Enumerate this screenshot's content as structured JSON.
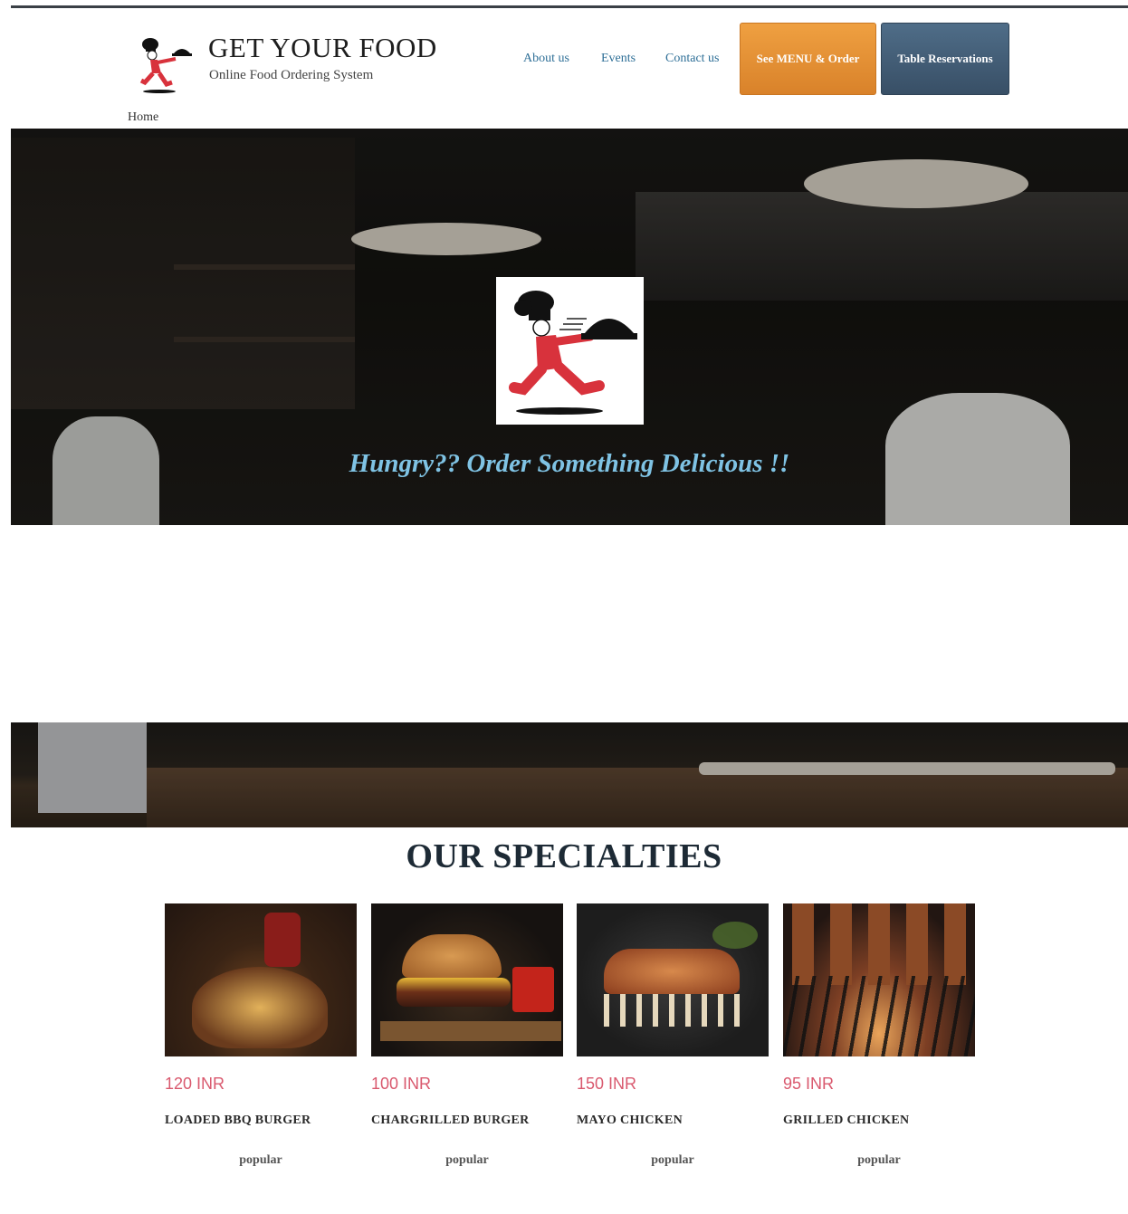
{
  "header": {
    "brand_title": "GET YOUR FOOD",
    "brand_subtitle": "Online Food Ordering System",
    "nav": [
      {
        "label": "About us"
      },
      {
        "label": "Events"
      },
      {
        "label": "Contact us"
      }
    ],
    "menu_button": "See MENU & Order",
    "table_button": "Table Reservations"
  },
  "breadcrumb": "Home",
  "hero": {
    "tagline": "Hungry?? Order Something Delicious !!"
  },
  "specialties": {
    "title": "OUR SPECIALTIES",
    "items": [
      {
        "price": "120 INR",
        "name": "LOADED BBQ BURGER",
        "tag": "popular"
      },
      {
        "price": "100 INR",
        "name": "CHARGRILLED BURGER",
        "tag": "popular"
      },
      {
        "price": "150 INR",
        "name": "MAYO CHICKEN",
        "tag": "popular"
      },
      {
        "price": "95 INR",
        "name": "GRILLED CHICKEN",
        "tag": "popular"
      }
    ]
  },
  "colors": {
    "menu_button": "#e08b2f",
    "table_button": "#42596f",
    "price": "#d9596e",
    "nav_link": "#2e6f97",
    "tagline": "#7fc3e4"
  }
}
